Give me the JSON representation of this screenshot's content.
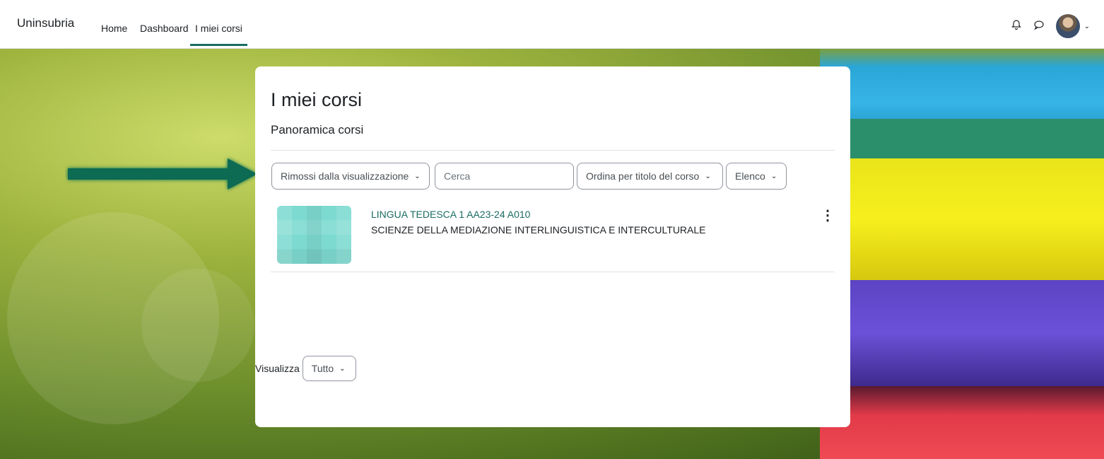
{
  "navbar": {
    "brand": "Uninsubria",
    "links": [
      {
        "label": "Home",
        "active": false
      },
      {
        "label": "Dashboard",
        "active": false
      },
      {
        "label": "I miei corsi",
        "active": true
      }
    ],
    "icons": [
      "bell-icon",
      "chat-icon",
      "avatar",
      "chevron-down-icon"
    ]
  },
  "page": {
    "title": "I miei corsi",
    "subtitle": "Panoramica corsi"
  },
  "filters": {
    "grouping": "Rimossi dalla visualizzazione",
    "search_placeholder": "Cerca",
    "sort": "Ordina per titolo del corso",
    "view": "Elenco"
  },
  "courses": [
    {
      "title": "LINGUA TEDESCA 1 AA23-24 A010",
      "category": "SCIENZE DELLA MEDIAZIONE INTERLINGUISTICA E INTERCULTURALE"
    }
  ],
  "footer": {
    "show_label": "Visualizza",
    "show_value": "Tutto"
  },
  "colors": {
    "accent": "#1a6d62",
    "arrow": "#0b6b52"
  }
}
